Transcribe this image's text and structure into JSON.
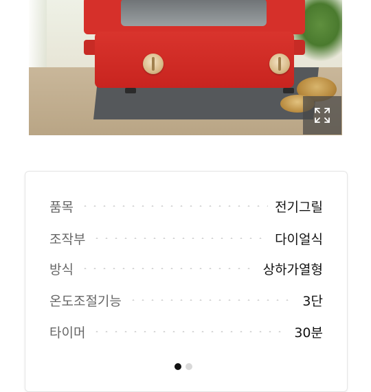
{
  "product_image": {
    "icon": "expand-icon"
  },
  "specs": {
    "rows": [
      {
        "label": "품목",
        "value": "전기그릴"
      },
      {
        "label": "조작부",
        "value": "다이얼식"
      },
      {
        "label": "방식",
        "value": "상하가열형"
      },
      {
        "label": "온도조절기능",
        "value": "3단"
      },
      {
        "label": "타이머",
        "value": "30분"
      }
    ]
  },
  "pager": {
    "active_index": 0,
    "count": 2
  }
}
